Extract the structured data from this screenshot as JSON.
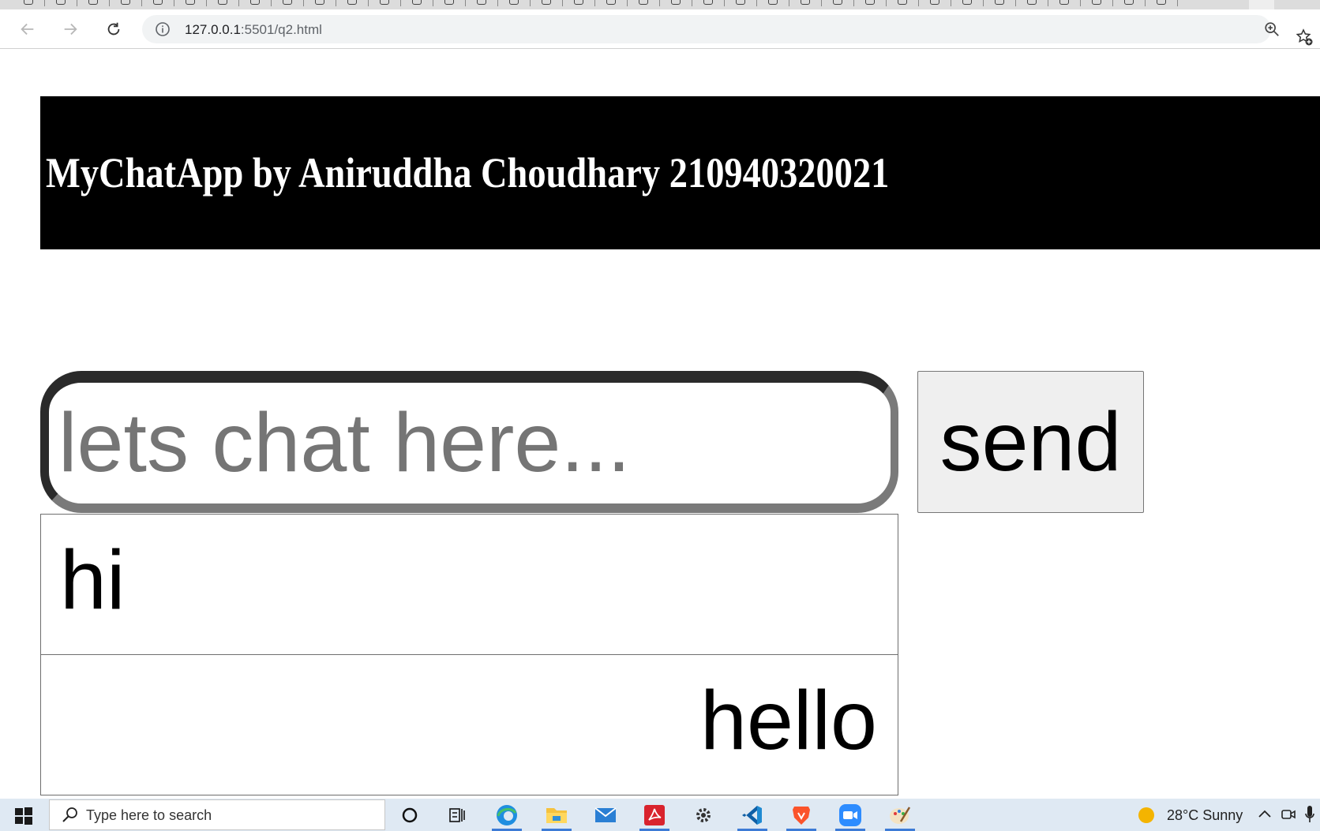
{
  "browser": {
    "url_host": "127.0.0.1",
    "url_rest": ":5501/q2.html"
  },
  "page": {
    "header_title": "MyChatApp by Aniruddha Choudhary 210940320021",
    "chat_input_placeholder": "lets chat here...",
    "send_label": "send",
    "messages": [
      {
        "text": "hi",
        "align": "left"
      },
      {
        "text": "hello",
        "align": "right"
      }
    ]
  },
  "taskbar": {
    "search_placeholder": "Type here to search",
    "weather": "28°C  Sunny",
    "pinned_icons": [
      "cortana-icon",
      "task-view-icon",
      "edge-icon",
      "file-explorer-icon",
      "mail-icon",
      "acrobat-icon",
      "settings-icon",
      "vscode-icon",
      "brave-icon",
      "zoom-icon",
      "paint-icon"
    ]
  },
  "colors": {
    "header_bg": "#000000",
    "header_text": "#ffffff",
    "button_bg": "#efefef",
    "taskbar_bg": "#dfe9f3"
  }
}
